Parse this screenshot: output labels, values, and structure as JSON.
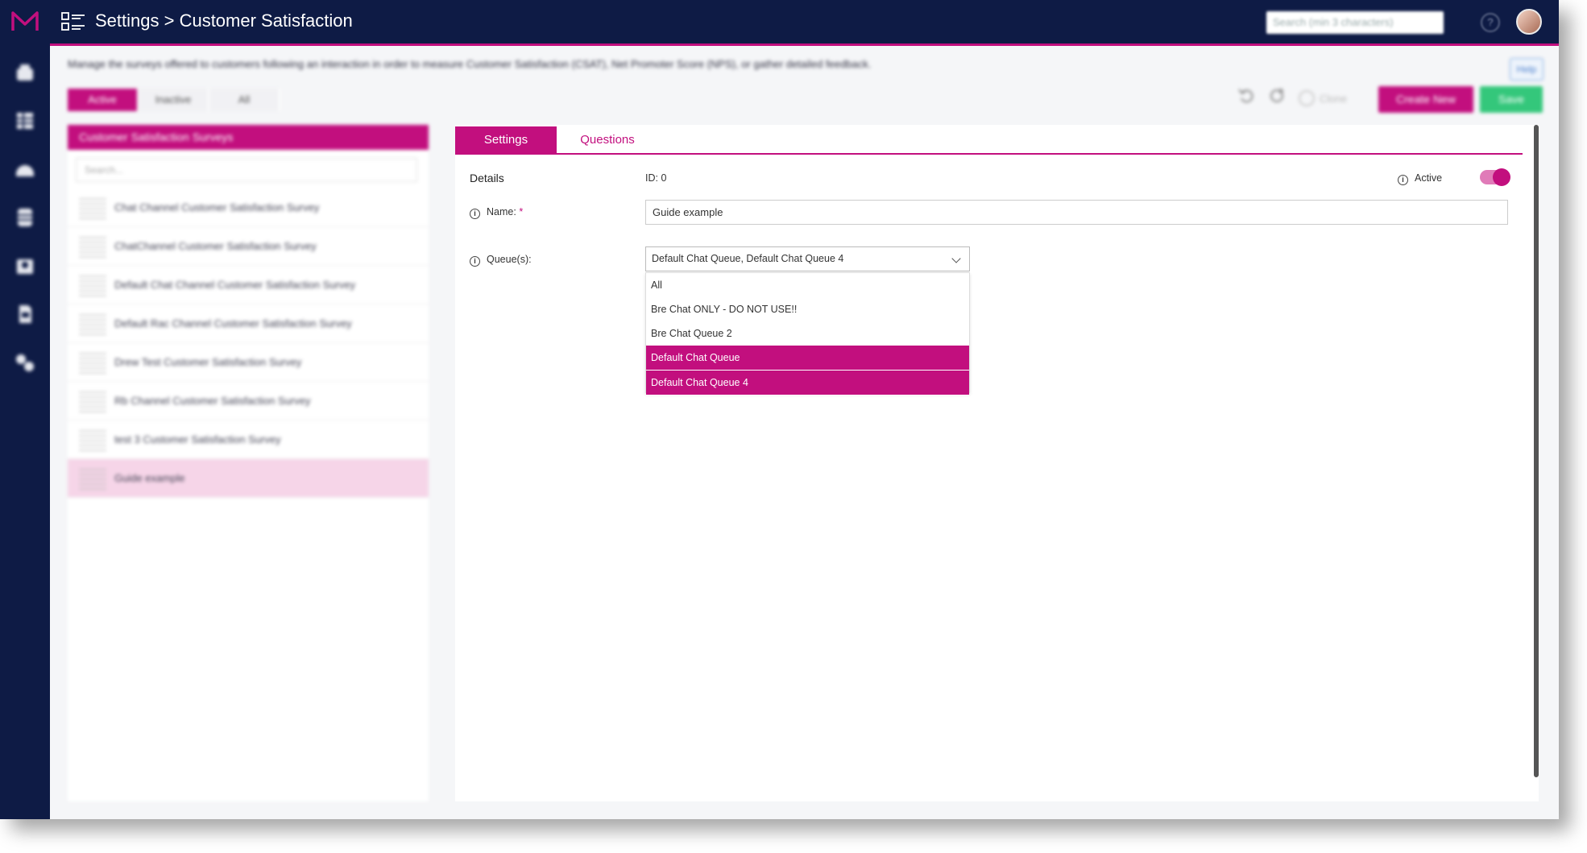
{
  "header": {
    "title": "Settings > Customer Satisfaction",
    "search_placeholder": "Search (min 3 characters)",
    "help_icon": "?"
  },
  "sidebar": {
    "icons": [
      "home-icon",
      "grid-icon",
      "dashboard-icon",
      "database-icon",
      "contacts-icon",
      "document-icon",
      "settings-icon"
    ]
  },
  "page": {
    "description": "Manage the surveys offered to customers following an interaction in order to measure Customer Satisfaction (CSAT), Net Promoter Score (NPS), or gather detailed feedback.",
    "help_label": "Help",
    "filter_tabs": [
      "Active",
      "Inactive",
      "All"
    ],
    "toolbar": {
      "clone_label": "Clone",
      "create_label": "Create New",
      "save_label": "Save"
    }
  },
  "survey_list": {
    "header": "Customer Satisfaction Surveys",
    "search_placeholder": "Search...",
    "items": [
      "Chat Channel Customer Satisfaction Survey",
      "ChatChannel Customer Satisfaction Survey",
      "Default Chat Channel Customer Satisfaction Survey",
      "Default Rac Channel Customer Satisfaction Survey",
      "Drew Test Customer Satisfaction Survey",
      "Rb Channel Customer Satisfaction Survey",
      "test 3 Customer Satisfaction Survey",
      "Guide example"
    ]
  },
  "details": {
    "tabs": [
      "Settings",
      "Questions"
    ],
    "section_label": "Details",
    "id_text": "ID: 0",
    "active_label": "Active",
    "active": true,
    "name_label": "Name:",
    "required_mark": "*",
    "name_value": "Guide example",
    "queues_label": "Queue(s):",
    "queues_value": "Default Chat Queue, Default Chat Queue 4",
    "queue_options": [
      {
        "label": "All",
        "selected": false
      },
      {
        "label": "Bre Chat ONLY - DO NOT USE!!",
        "selected": false
      },
      {
        "label": "Bre Chat Queue 2",
        "selected": false
      },
      {
        "label": "Default Chat Queue",
        "selected": true
      },
      {
        "label": "Default Chat Queue 4",
        "selected": true
      }
    ]
  },
  "colors": {
    "brand": "#c20f7e",
    "nav": "#0e1b45",
    "save": "#34c77b"
  }
}
